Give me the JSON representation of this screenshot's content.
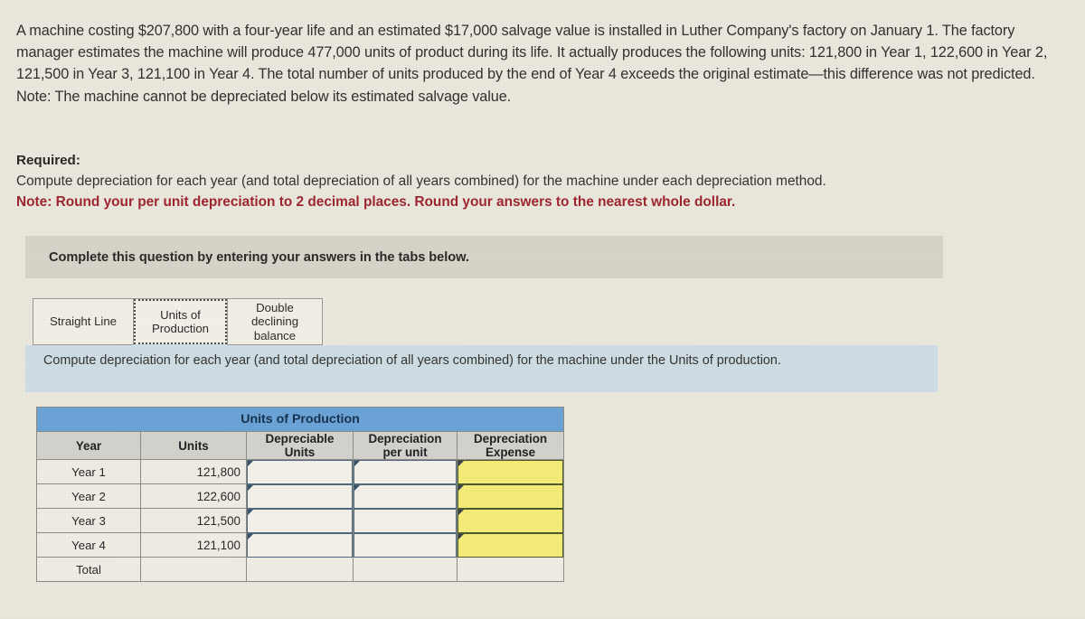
{
  "problem": {
    "text": "A machine costing $207,800 with a four-year life and an estimated $17,000 salvage value is installed in Luther Company's factory on January 1. The factory manager estimates the machine will produce 477,000 units of product during its life. It actually produces the following units: 121,800 in Year 1, 122,600 in Year 2, 121,500 in Year 3, 121,100 in Year 4. The total number of units produced by the end of Year 4 exceeds the original estimate—this difference was not predicted. Note: The machine cannot be depreciated below its estimated salvage value."
  },
  "required": {
    "title": "Required:",
    "body": "Compute depreciation for each year (and total depreciation of all years combined) for the machine under each depreciation method.",
    "note": "Note: Round your per unit depreciation to 2 decimal places. Round your answers to the nearest whole dollar."
  },
  "gray_bar": {
    "text": "Complete this question by entering your answers in the tabs below."
  },
  "tabs": {
    "items": [
      {
        "label": "Straight Line",
        "active": false
      },
      {
        "label": "Units of Production",
        "active": true
      },
      {
        "label": "Double declining balance",
        "active": false
      }
    ],
    "straight_line": "Straight Line",
    "units_of_production_l1": "Units of",
    "units_of_production_l2": "Production",
    "ddb_l1": "Double",
    "ddb_l2": "declining",
    "ddb_l3": "balance"
  },
  "instruction": {
    "text": "Compute depreciation for each year (and total depreciation of all years combined) for the machine under the Units of production."
  },
  "table": {
    "title": "Units of Production",
    "headers": {
      "year": "Year",
      "units": "Units",
      "depreciable_units_l1": "Depreciable",
      "depreciable_units_l2": "Units",
      "dep_per_unit_l1": "Depreciation",
      "dep_per_unit_l2": "per unit",
      "dep_expense_l1": "Depreciation",
      "dep_expense_l2": "Expense"
    },
    "rows": [
      {
        "year": "Year 1",
        "units": "121,800",
        "depreciable_units": "",
        "dep_per_unit": "",
        "dep_expense": ""
      },
      {
        "year": "Year 2",
        "units": "122,600",
        "depreciable_units": "",
        "dep_per_unit": "",
        "dep_expense": ""
      },
      {
        "year": "Year 3",
        "units": "121,500",
        "depreciable_units": "",
        "dep_per_unit": "",
        "dep_expense": ""
      },
      {
        "year": "Year 4",
        "units": "121,100",
        "depreciable_units": "",
        "dep_per_unit": "",
        "dep_expense": ""
      }
    ],
    "total": {
      "year": "Total",
      "units": "",
      "depreciable_units": "",
      "dep_per_unit": "",
      "dep_expense": ""
    }
  },
  "colors": {
    "page_background": "#eae7dd",
    "gray_bar": "#d6d3c9",
    "blue_bar": "#cedce4",
    "table_title_blue": "#6ba3d6",
    "table_header_gray": "#d2d1cb",
    "input_yellow": "#f4ec77",
    "note_red": "#9e2630"
  }
}
